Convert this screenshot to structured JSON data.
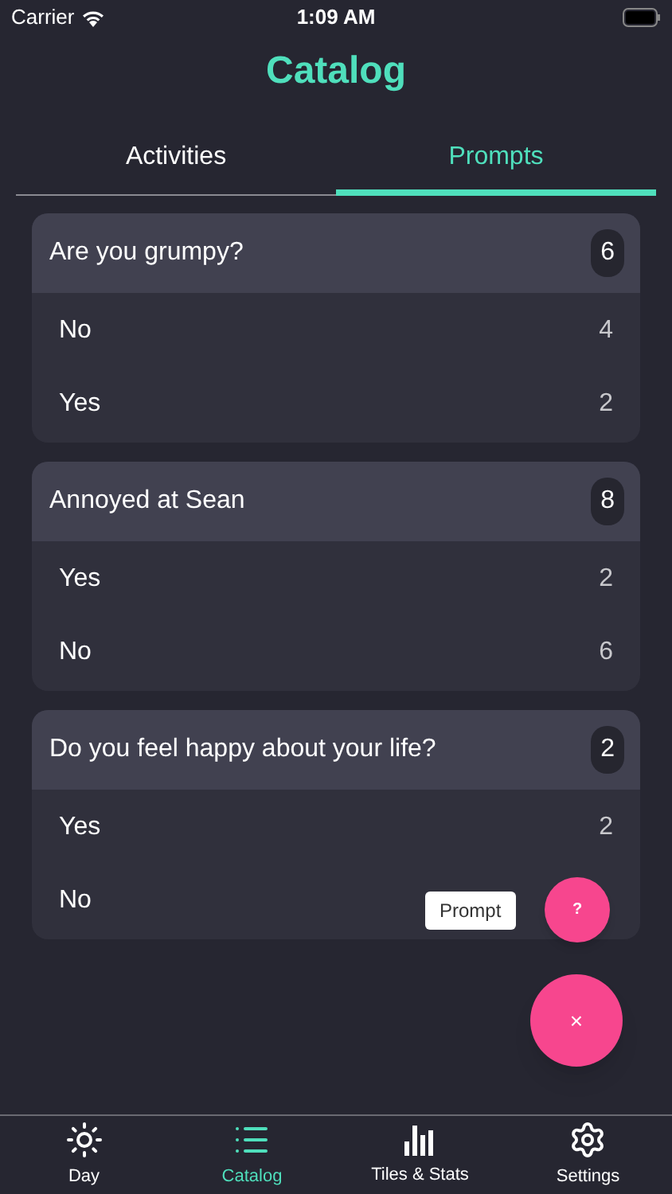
{
  "status_bar": {
    "carrier": "Carrier",
    "time": "1:09 AM"
  },
  "title": "Catalog",
  "tabs": [
    {
      "label": "Activities",
      "selected": false
    },
    {
      "label": "Prompts",
      "selected": true
    }
  ],
  "prompts": [
    {
      "question": "Are you grumpy?",
      "count": "6",
      "answers": [
        {
          "label": "No",
          "count": "4"
        },
        {
          "label": "Yes",
          "count": "2"
        }
      ]
    },
    {
      "question": "Annoyed at Sean",
      "count": "8",
      "answers": [
        {
          "label": "Yes",
          "count": "2"
        },
        {
          "label": "No",
          "count": "6"
        }
      ]
    },
    {
      "question": "Do you feel happy about your life?",
      "count": "2",
      "answers": [
        {
          "label": "Yes",
          "count": "2"
        },
        {
          "label": "No"
        }
      ]
    }
  ],
  "fab_menu": {
    "tooltip": "Prompt",
    "action_symbol": "?",
    "close_symbol": "×"
  },
  "bottom_nav": [
    {
      "label": "Day",
      "selected": false
    },
    {
      "label": "Catalog",
      "selected": true
    },
    {
      "label": "Tiles & Stats",
      "selected": false
    },
    {
      "label": "Settings",
      "selected": false
    }
  ]
}
